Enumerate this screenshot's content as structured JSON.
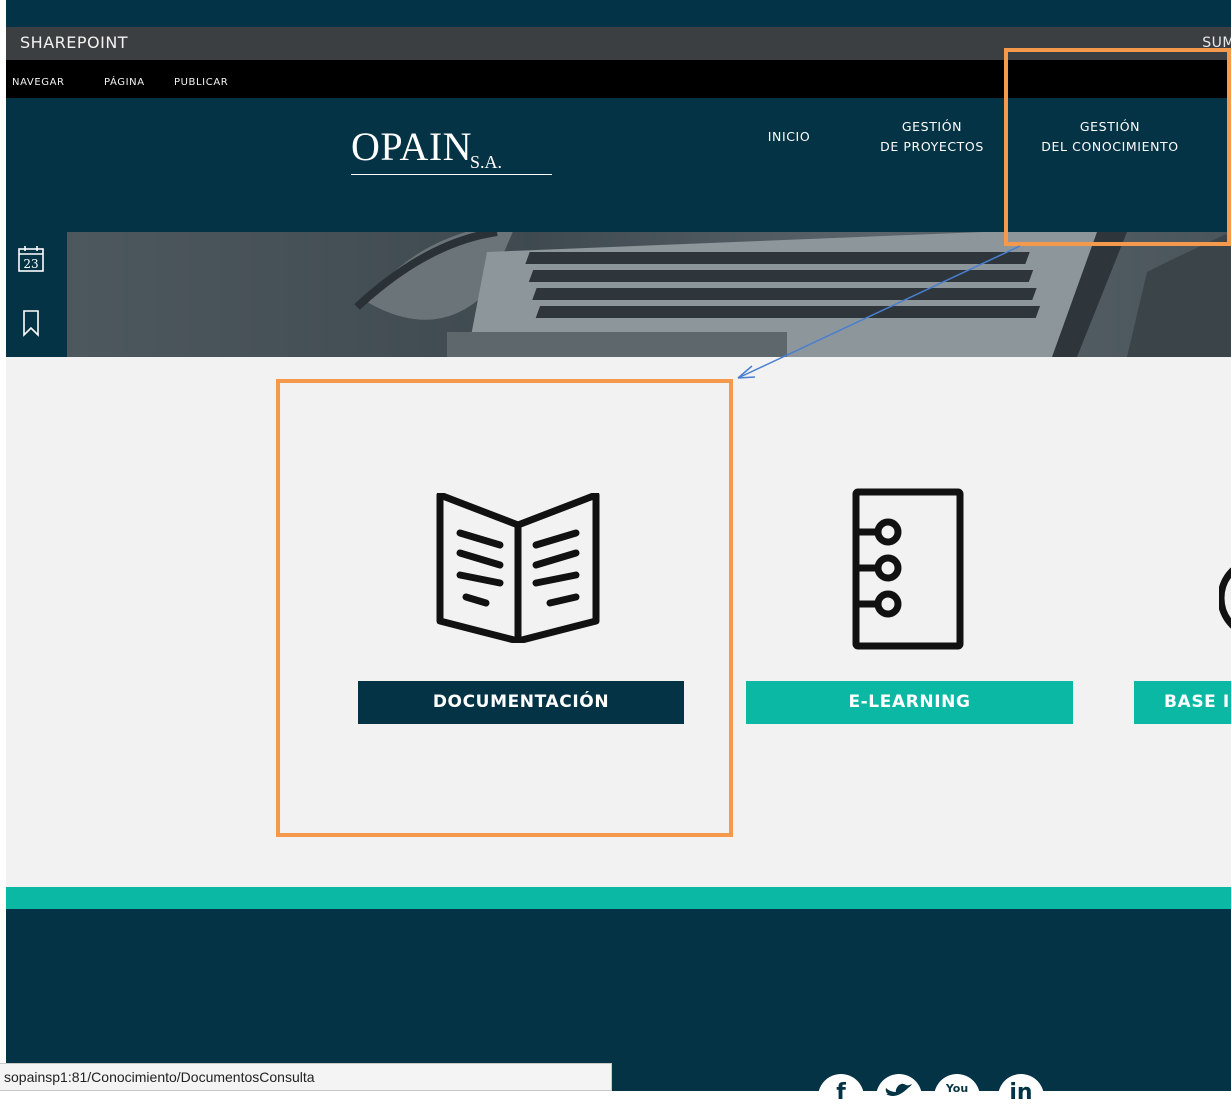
{
  "suite_bar": {
    "title": "SHAREPOINT",
    "right_text": "SUM"
  },
  "ribbon": {
    "items": [
      "NAVEGAR",
      "PÁGINA",
      "PUBLICAR"
    ]
  },
  "header": {
    "logo_main": "OPAIN",
    "logo_suffix": "S.A.",
    "nav": [
      {
        "line1": "INICIO",
        "line2": ""
      },
      {
        "line1": "GESTIÓN",
        "line2": "DE PROYECTOS"
      },
      {
        "line1": "GESTIÓN",
        "line2": "DEL CONOCIMIENTO"
      }
    ]
  },
  "rail": {
    "calendar_day": "23",
    "icons": [
      "calendar-icon",
      "bookmark-icon",
      "pin-icon",
      "documents-icon",
      "window-icon"
    ]
  },
  "tiles": [
    {
      "label": "DOCUMENTACIÓN",
      "icon": "open-book-icon",
      "color": "#043345"
    },
    {
      "label": "E-LEARNING",
      "icon": "notebook-icon",
      "color": "#0ab8a4"
    },
    {
      "label": "BASE I",
      "icon": "partial-icon",
      "color": "#0ab8a4"
    }
  ],
  "footer": {
    "social": [
      {
        "icon": "facebook-icon",
        "glyph": "f"
      },
      {
        "icon": "twitter-icon",
        "glyph": ""
      },
      {
        "icon": "youtube-icon",
        "glyph": "You"
      },
      {
        "icon": "linkedin-icon",
        "glyph": "in"
      }
    ]
  },
  "status_bar": {
    "url": "sopainsp1:81/Conocimiento/DocumentosConsulta"
  },
  "colors": {
    "navy": "#043345",
    "teal": "#0ab8a4",
    "highlight": "#f59a4c",
    "arrow": "#4a7fd0"
  }
}
